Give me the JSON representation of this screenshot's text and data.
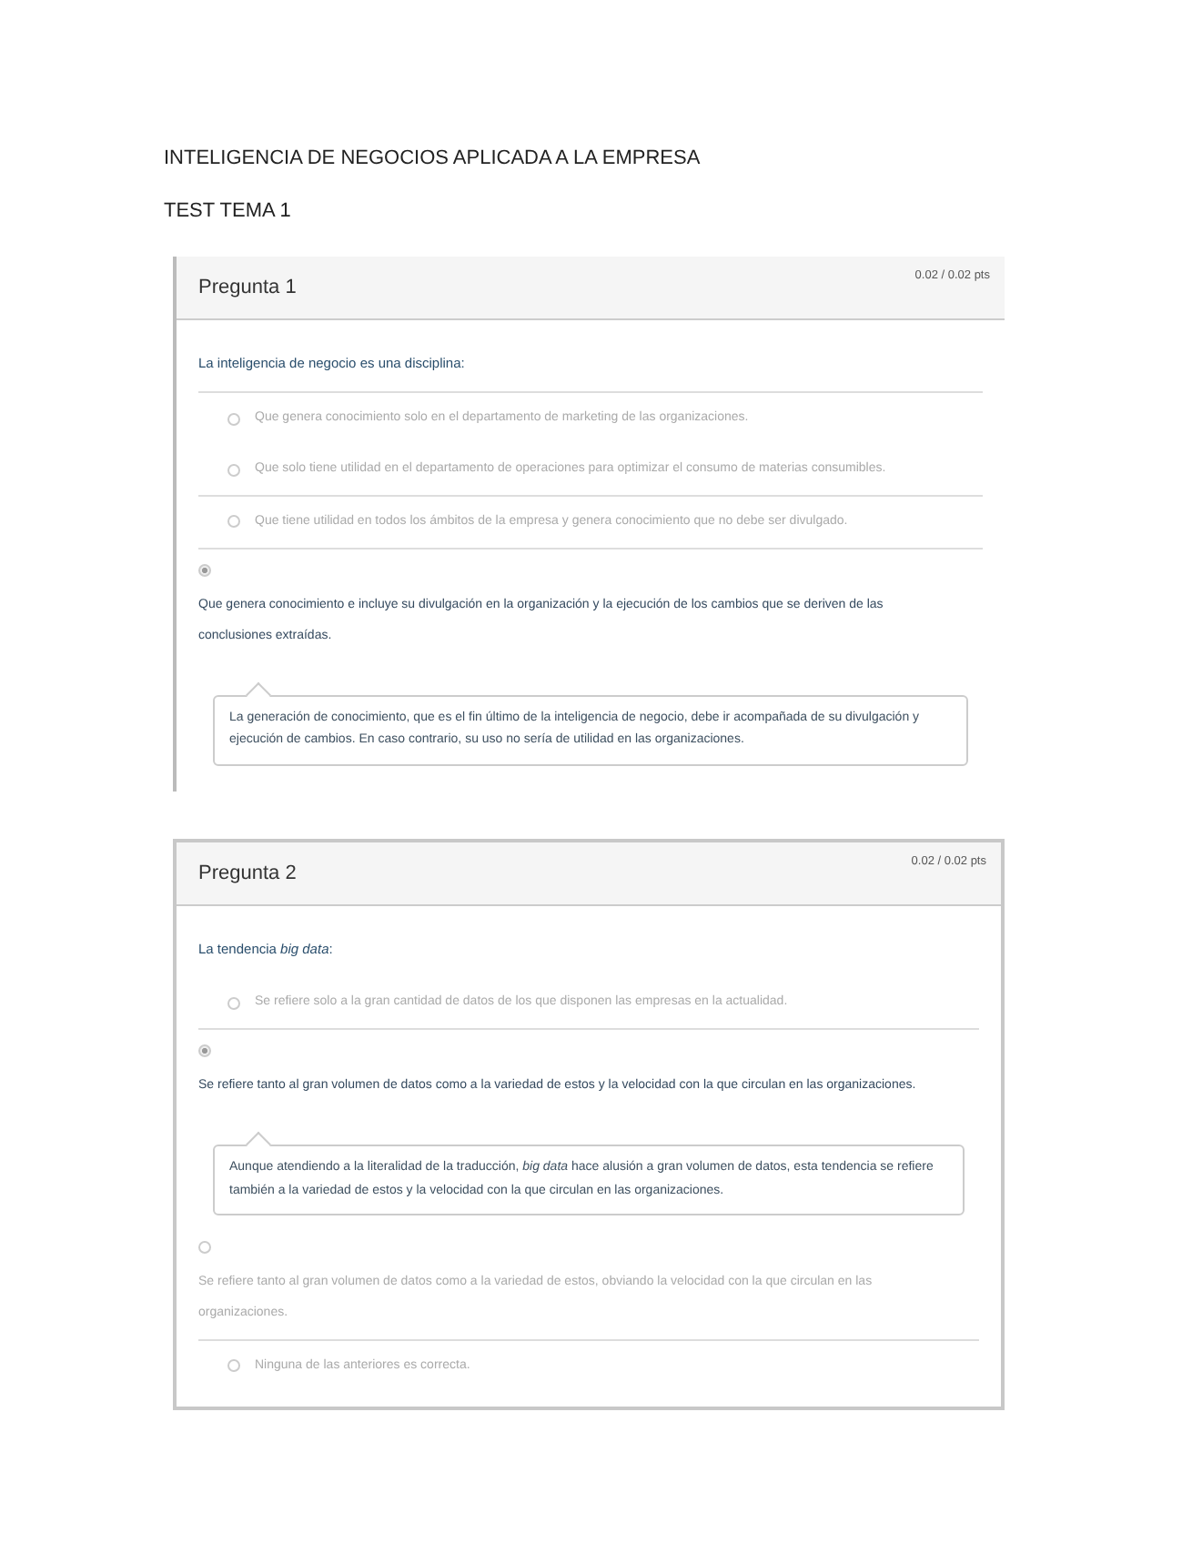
{
  "document": {
    "title": "INTELIGENCIA DE NEGOCIOS APLICADA A LA EMPRESA",
    "subtitle": "TEST TEMA 1"
  },
  "questions": [
    {
      "kind": "partial",
      "title": "Pregunta 1",
      "points": "0.02 / 0.02 pts",
      "prompt": "La inteligencia de negocio es una disciplina:",
      "prompt_divider": true,
      "options": [
        {
          "kind": "inline",
          "text": "Que genera conocimiento solo en el departamento de marketing de las organizaciones.",
          "selected": false,
          "divider_above": false
        },
        {
          "kind": "inline",
          "text": "Que solo tiene utilidad en el departamento de operaciones para optimizar el consumo de materias consumibles.",
          "selected": false,
          "divider_above": false
        },
        {
          "kind": "inline",
          "text": "Que tiene utilidad en todos los ámbitos de la empresa y genera conocimiento que no debe ser divulgado.",
          "selected": false,
          "divider_above": true
        },
        {
          "kind": "stacked",
          "text": "Que genera conocimiento e incluye su divulgación en la organización y la ejecución de los cambios que se deriven de las conclusiones extraídas.",
          "selected": true,
          "divider_above": true,
          "feedback": "La generación de conocimiento, que es el fin último de la inteligencia de negocio, debe ir acompañada de su divulgación y ejecución de cambios. En caso contrario, su uso no sería de utilidad en las organizaciones."
        }
      ]
    },
    {
      "kind": "full",
      "title": "Pregunta 2",
      "points": "0.02 / 0.02 pts",
      "prompt": "La tendencia *big data*:",
      "prompt_divider": false,
      "options": [
        {
          "kind": "inline",
          "text": "Se refiere solo a la gran cantidad de datos de los que disponen las empresas en la actualidad.",
          "selected": false,
          "divider_above": false
        },
        {
          "kind": "stacked",
          "text": "Se refiere tanto al gran volumen de datos como a la variedad de estos y la velocidad con la que circulan en las organizaciones.",
          "selected": true,
          "divider_above": true,
          "feedback": "Aunque atendiendo a la literalidad de la traducción, *big data* hace alusión a gran volumen de datos, esta tendencia se refiere también a la variedad de estos y la velocidad con la que circulan en las organizaciones."
        },
        {
          "kind": "stacked",
          "text": "Se refiere tanto al gran volumen de datos como a la variedad de estos, obviando la velocidad con la que circulan en las organizaciones.",
          "selected": false,
          "divider_above": false
        },
        {
          "kind": "inline",
          "text": "Ninguna de las anteriores es correcta.",
          "selected": false,
          "divider_above": true
        }
      ]
    }
  ]
}
